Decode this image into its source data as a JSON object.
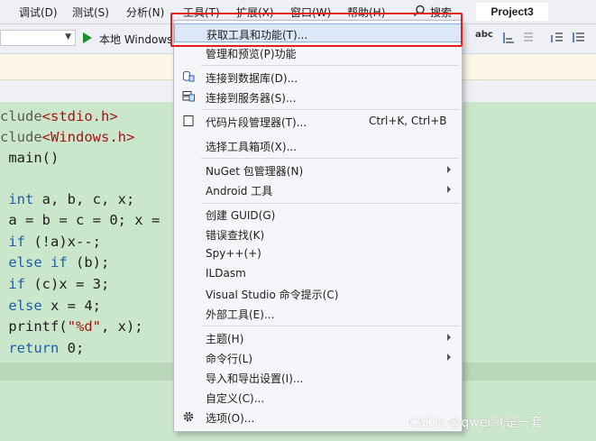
{
  "menubar": {
    "items": [
      "调试(D)",
      "测试(S)",
      "分析(N)",
      "工具(T)",
      "扩展(X)",
      "窗口(W)",
      "帮助(H)"
    ],
    "search_label": "搜索",
    "project_title": "Project3"
  },
  "toolbar": {
    "run_label": "本地 Windows",
    "abc_label": "abc"
  },
  "code": {
    "lines": [
      {
        "parts": [
          {
            "t": "clude",
            "c": "pp"
          },
          {
            "t": "<stdio.h>",
            "c": "inc"
          }
        ]
      },
      {
        "parts": [
          {
            "t": "clude",
            "c": "pp"
          },
          {
            "t": "<Windows.h>",
            "c": "inc"
          }
        ]
      },
      {
        "parts": [
          {
            "t": " main()",
            "c": ""
          }
        ]
      },
      {
        "parts": [
          {
            "t": "",
            "c": ""
          }
        ]
      },
      {
        "parts": [
          {
            "t": " ",
            "c": ""
          },
          {
            "t": "int",
            "c": "kw"
          },
          {
            "t": " a, b, c, x;",
            "c": ""
          }
        ]
      },
      {
        "parts": [
          {
            "t": " a = b = c = 0; x = ",
            "c": ""
          }
        ]
      },
      {
        "parts": [
          {
            "t": " ",
            "c": ""
          },
          {
            "t": "if",
            "c": "kw"
          },
          {
            "t": " (!a)x--;",
            "c": ""
          }
        ]
      },
      {
        "parts": [
          {
            "t": " ",
            "c": ""
          },
          {
            "t": "else if",
            "c": "kw"
          },
          {
            "t": " (b);",
            "c": ""
          }
        ]
      },
      {
        "parts": [
          {
            "t": " ",
            "c": ""
          },
          {
            "t": "if",
            "c": "kw"
          },
          {
            "t": " (c)x = 3;",
            "c": ""
          }
        ]
      },
      {
        "parts": [
          {
            "t": " ",
            "c": ""
          },
          {
            "t": "else",
            "c": "kw"
          },
          {
            "t": " x = 4;",
            "c": ""
          }
        ]
      },
      {
        "parts": [
          {
            "t": " printf(",
            "c": ""
          },
          {
            "t": "\"%d\"",
            "c": "str"
          },
          {
            "t": ", x);",
            "c": ""
          }
        ]
      },
      {
        "parts": [
          {
            "t": " ",
            "c": ""
          },
          {
            "t": "return",
            "c": "kw"
          },
          {
            "t": " 0;",
            "c": ""
          }
        ]
      }
    ]
  },
  "tools_menu": {
    "get_tools": "获取工具和功能(T)...",
    "manage_preview": "管理和预览(P)功能",
    "connect_db": "连接到数据库(D)...",
    "connect_server": "连接到服务器(S)...",
    "snippet_manager": "代码片段管理器(T)...",
    "snippet_shortcut": "Ctrl+K, Ctrl+B",
    "choose_toolbox": "选择工具箱项(X)...",
    "nuget": "NuGet 包管理器(N)",
    "android": "Android 工具",
    "create_guid": "创建 GUID(G)",
    "error_lookup": "错误查找(K)",
    "spy": "Spy++(+)",
    "ildasm": "ILDasm",
    "vs_cmd": "Visual Studio 命令提示(C)",
    "external_tools": "外部工具(E)...",
    "theme": "主题(H)",
    "command_line": "命令行(L)",
    "import_export": "导入和导出设置(I)...",
    "customize": "自定义(C)...",
    "options": "选项(O)..."
  },
  "watermark": "CSDN @qwer就是一套",
  "colors": {
    "editor_bg": "#cbe7cb",
    "keyword": "#1e5fa8",
    "string": "#a31515",
    "highlight_border": "#e02020",
    "run_green": "#1e8f2e"
  }
}
